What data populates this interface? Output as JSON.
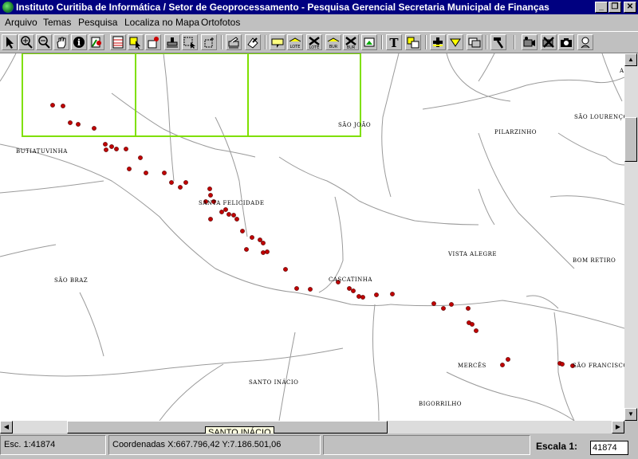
{
  "window": {
    "title": "Instituto Curitiba de Informática / Setor de Geoprocessamento - Pesquisa Gerencial Secretaria Municipal de Finanças",
    "minimize": "_",
    "restore": "❐",
    "close": "✕"
  },
  "menu": [
    "Arquivo",
    "Temas",
    "Pesquisa",
    "Localiza no Mapa",
    "Ortofotos"
  ],
  "toolbar": {
    "icons": [
      "pointer-icon",
      "zoom-in-icon",
      "zoom-out-icon",
      "pan-hand-icon",
      "info-icon",
      "identify-icon",
      "table-icon",
      "select-icon",
      "locate-icon",
      "stamp-icon",
      "select-box-icon",
      "select-area-icon",
      "print-icon",
      "export-icon",
      "label-icon",
      "lote-icon",
      "lote-clear-icon",
      "bur-icon",
      "bur-clear-icon",
      "legend-icon",
      "text-icon",
      "text-style-icon",
      "add-icon",
      "fill-icon",
      "layers-icon",
      "hammer-icon",
      "camera-video-icon",
      "camera-off-icon",
      "photo-icon",
      "help-icon"
    ],
    "lote_label": "LOTE",
    "bur_label": "BUR",
    "text_glyph": "T",
    "info_glyph": "i"
  },
  "map": {
    "labels": [
      {
        "text": "SÃO JOÃO",
        "key": "sao_joao"
      },
      {
        "text": "SÃO LOURENÇO",
        "key": "sao_lourenco"
      },
      {
        "text": "PILARZINHO",
        "key": "pilarzinho"
      },
      {
        "text": "BUTIATUVINHA",
        "key": "butiatuvinha"
      },
      {
        "text": "SANTA FELICIDADE",
        "key": "santa_felicidade"
      },
      {
        "text": "VISTA ALEGRE",
        "key": "vista_alegre"
      },
      {
        "text": "BOM RETIRO",
        "key": "bom_retiro"
      },
      {
        "text": "SÃO BRAZ",
        "key": "sao_braz"
      },
      {
        "text": "CASCATINHA",
        "key": "cascatinha"
      },
      {
        "text": "MERCÊS",
        "key": "merces"
      },
      {
        "text": "SÃO FRANCISCO",
        "key": "sao_francisco"
      },
      {
        "text": "SANTO INÁCIO",
        "key": "santo_inacio"
      },
      {
        "text": "BIGORRILHO",
        "key": "bigorrilho"
      },
      {
        "text": "A",
        "key": "a_edge"
      }
    ],
    "colors": {
      "boundary": "#9a9a9a",
      "grid": "#7fe000",
      "point": "#c00000",
      "point_stroke": "#500000"
    }
  },
  "tooltip": "SANTO INÁCIO",
  "status": {
    "scale_text": "Esc. 1:41874",
    "coords_text": "Coordenadas X:667.796,42  Y:7.186.501,06",
    "scale_label": "Escala 1:",
    "scale_value": "41874"
  }
}
